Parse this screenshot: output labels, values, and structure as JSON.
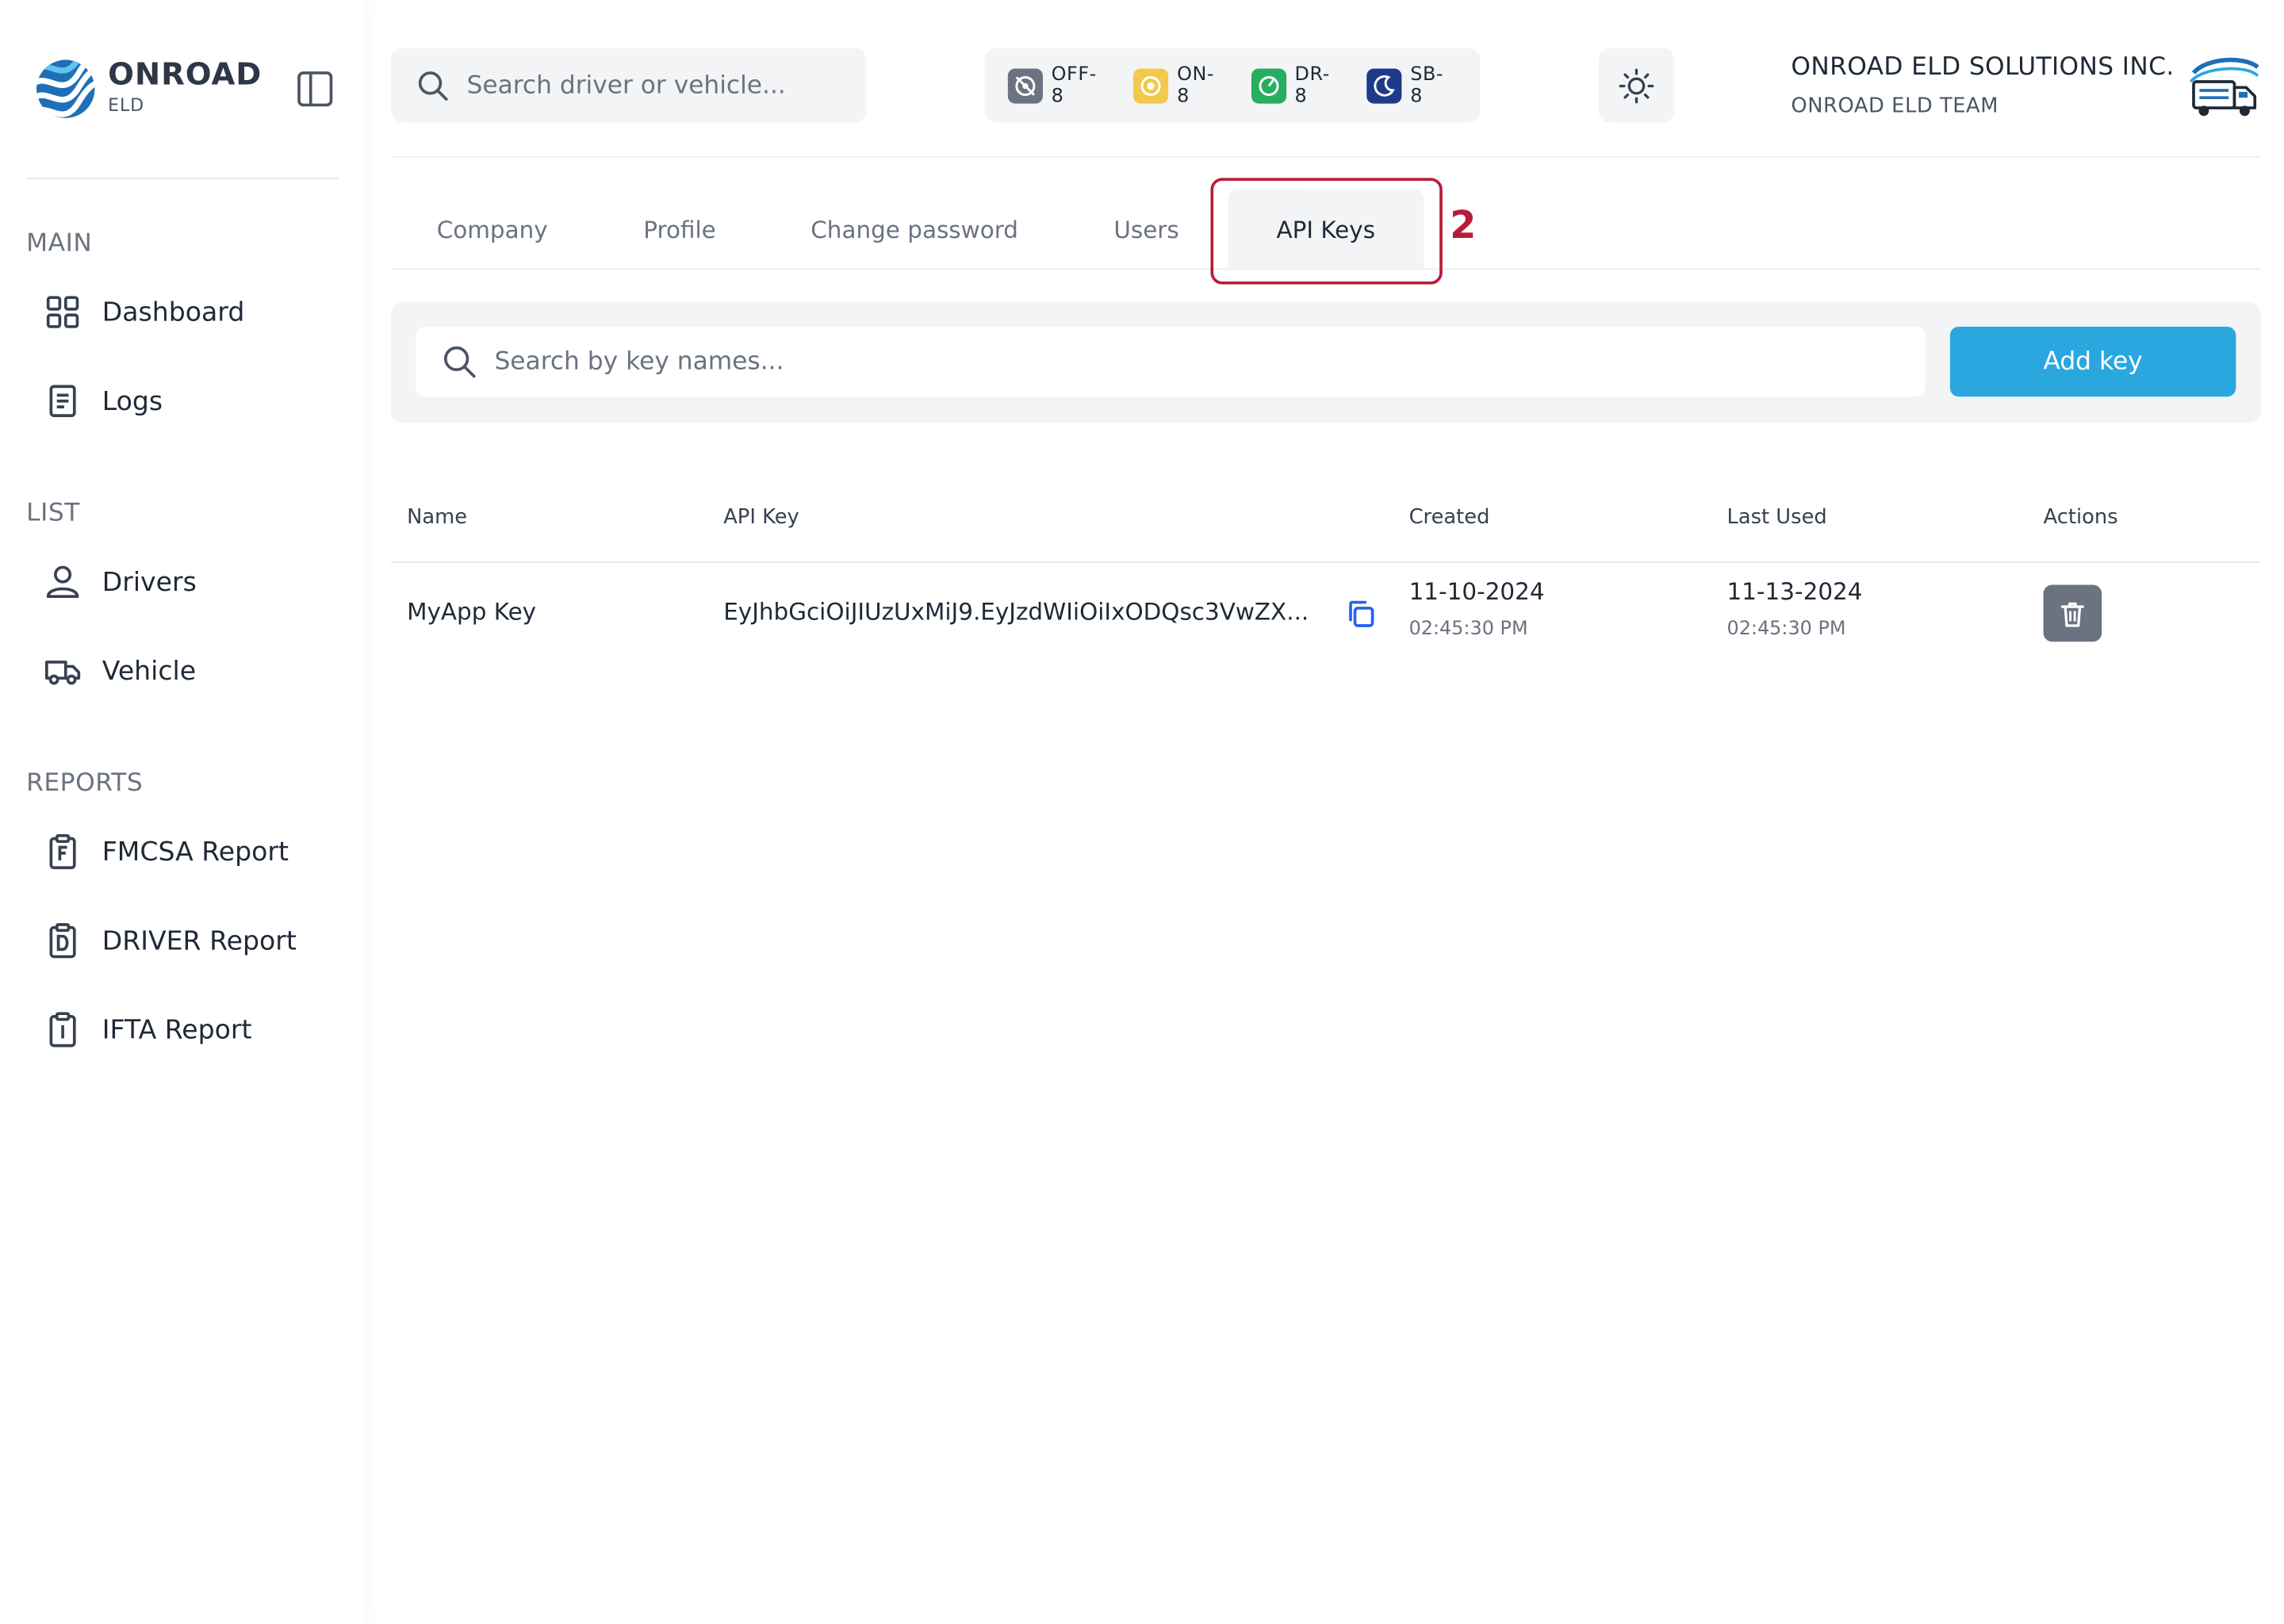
{
  "brand": {
    "name": "ONROAD",
    "sub": "ELD",
    "colors": {
      "primary": "#1e6fb8",
      "accent": "#2ba7df"
    }
  },
  "sidebar": {
    "sections": [
      {
        "title": "MAIN",
        "items": [
          {
            "label": "Dashboard",
            "icon": "dashboard-grid-icon"
          },
          {
            "label": "Logs",
            "icon": "document-icon"
          }
        ]
      },
      {
        "title": "LIST",
        "items": [
          {
            "label": "Drivers",
            "icon": "user-icon"
          },
          {
            "label": "Vehicle",
            "icon": "truck-icon"
          }
        ]
      },
      {
        "title": "REPORTS",
        "items": [
          {
            "label": "FMCSA Report",
            "icon": "clipboard-f-icon"
          },
          {
            "label": "DRIVER Report",
            "icon": "clipboard-d-icon"
          },
          {
            "label": "IFTA Report",
            "icon": "clipboard-i-icon"
          }
        ]
      }
    ]
  },
  "header": {
    "search_placeholder": "Search driver or vehicle...",
    "statuses": [
      {
        "label": "OFF-8",
        "color": "#6b7280"
      },
      {
        "label": "ON-8",
        "color": "#f2c94c"
      },
      {
        "label": "DR-8",
        "color": "#27ae60"
      },
      {
        "label": "SB-8",
        "color": "#1e3a8a"
      }
    ],
    "company_name": "ONROAD ELD SOLUTIONS INC.",
    "company_team": "ONROAD ELD TEAM"
  },
  "tabs": [
    {
      "label": "Company",
      "active": false
    },
    {
      "label": "Profile",
      "active": false
    },
    {
      "label": "Change password",
      "active": false
    },
    {
      "label": "Users",
      "active": false
    },
    {
      "label": "API Keys",
      "active": true
    }
  ],
  "annotation": {
    "step": "2",
    "color": "#b91c3a"
  },
  "toolbar": {
    "search_placeholder": "Search by key names...",
    "add_label": "Add key"
  },
  "table": {
    "headers": [
      "Name",
      "API Key",
      "Created",
      "Last Used",
      "Actions"
    ],
    "rows": [
      {
        "name": "MyApp Key",
        "api_key": "EyJhbGciOiJIUzUxMiJ9.EyJzdWIiOiIxODQsc3VwZX...",
        "created_date": "11-10-2024",
        "created_time": "02:45:30 PM",
        "used_date": "11-13-2024",
        "used_time": "02:45:30 PM"
      }
    ]
  }
}
